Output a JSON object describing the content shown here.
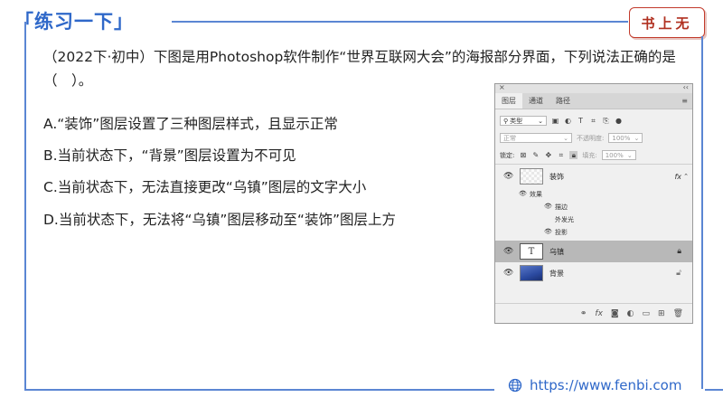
{
  "header": {
    "title": "「练习一下」",
    "badge": "书上无"
  },
  "question": {
    "stem": "（2022下·初中）下图是用Photoshop软件制作“世界互联网大会”的海报部分界面，下列说法正确的是（　）。",
    "options": [
      "A.“装饰”图层设置了三种图层样式，且显示正常",
      "B.当前状态下，“背景”图层设置为不可见",
      "C.当前状态下，无法直接更改“乌镇”图层的文字大小",
      "D.当前状态下，无法将“乌镇”图层移动至“装饰”图层上方"
    ]
  },
  "panel": {
    "close_glyph": "×",
    "collapse_glyph": "‹‹",
    "tabs": [
      "图层",
      "通道",
      "路径"
    ],
    "active_tab": 0,
    "menu_glyph": "≡",
    "filter": "类型",
    "blend_mode": "正常",
    "opacity_label": "不透明度:",
    "opacity_value": "100%",
    "lock_label": "锁定:",
    "fill_label": "填充:",
    "fill_value": "100%",
    "layers": [
      {
        "name": "装饰",
        "fx": "fx",
        "effects_label": "效果",
        "effects": [
          "描边",
          "外发光",
          "投影"
        ]
      },
      {
        "name": "乌镇",
        "type_glyph": "T"
      },
      {
        "name": "背景"
      }
    ],
    "icons": [
      "link-icon",
      "fx-icon",
      "mask-icon",
      "adjustment-icon",
      "group-icon",
      "new-layer-icon",
      "trash-icon"
    ]
  },
  "footer": {
    "url": "https://www.fenbi.com"
  },
  "colors": {
    "accent": "#2f68c9",
    "badge_red": "#b03020",
    "selected_layer": "#b8b8b8"
  }
}
